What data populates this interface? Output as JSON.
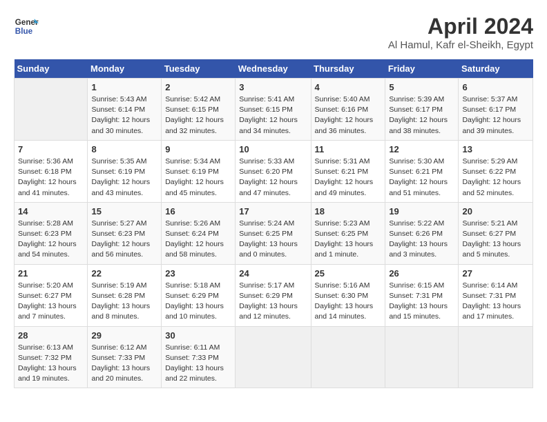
{
  "header": {
    "logo_line1": "General",
    "logo_line2": "Blue",
    "title": "April 2024",
    "subtitle": "Al Hamul, Kafr el-Sheikh, Egypt"
  },
  "calendar": {
    "days_of_week": [
      "Sunday",
      "Monday",
      "Tuesday",
      "Wednesday",
      "Thursday",
      "Friday",
      "Saturday"
    ],
    "weeks": [
      [
        {
          "day": "",
          "info": ""
        },
        {
          "day": "1",
          "info": "Sunrise: 5:43 AM\nSunset: 6:14 PM\nDaylight: 12 hours\nand 30 minutes."
        },
        {
          "day": "2",
          "info": "Sunrise: 5:42 AM\nSunset: 6:15 PM\nDaylight: 12 hours\nand 32 minutes."
        },
        {
          "day": "3",
          "info": "Sunrise: 5:41 AM\nSunset: 6:15 PM\nDaylight: 12 hours\nand 34 minutes."
        },
        {
          "day": "4",
          "info": "Sunrise: 5:40 AM\nSunset: 6:16 PM\nDaylight: 12 hours\nand 36 minutes."
        },
        {
          "day": "5",
          "info": "Sunrise: 5:39 AM\nSunset: 6:17 PM\nDaylight: 12 hours\nand 38 minutes."
        },
        {
          "day": "6",
          "info": "Sunrise: 5:37 AM\nSunset: 6:17 PM\nDaylight: 12 hours\nand 39 minutes."
        }
      ],
      [
        {
          "day": "7",
          "info": "Sunrise: 5:36 AM\nSunset: 6:18 PM\nDaylight: 12 hours\nand 41 minutes."
        },
        {
          "day": "8",
          "info": "Sunrise: 5:35 AM\nSunset: 6:19 PM\nDaylight: 12 hours\nand 43 minutes."
        },
        {
          "day": "9",
          "info": "Sunrise: 5:34 AM\nSunset: 6:19 PM\nDaylight: 12 hours\nand 45 minutes."
        },
        {
          "day": "10",
          "info": "Sunrise: 5:33 AM\nSunset: 6:20 PM\nDaylight: 12 hours\nand 47 minutes."
        },
        {
          "day": "11",
          "info": "Sunrise: 5:31 AM\nSunset: 6:21 PM\nDaylight: 12 hours\nand 49 minutes."
        },
        {
          "day": "12",
          "info": "Sunrise: 5:30 AM\nSunset: 6:21 PM\nDaylight: 12 hours\nand 51 minutes."
        },
        {
          "day": "13",
          "info": "Sunrise: 5:29 AM\nSunset: 6:22 PM\nDaylight: 12 hours\nand 52 minutes."
        }
      ],
      [
        {
          "day": "14",
          "info": "Sunrise: 5:28 AM\nSunset: 6:23 PM\nDaylight: 12 hours\nand 54 minutes."
        },
        {
          "day": "15",
          "info": "Sunrise: 5:27 AM\nSunset: 6:23 PM\nDaylight: 12 hours\nand 56 minutes."
        },
        {
          "day": "16",
          "info": "Sunrise: 5:26 AM\nSunset: 6:24 PM\nDaylight: 12 hours\nand 58 minutes."
        },
        {
          "day": "17",
          "info": "Sunrise: 5:24 AM\nSunset: 6:25 PM\nDaylight: 13 hours\nand 0 minutes."
        },
        {
          "day": "18",
          "info": "Sunrise: 5:23 AM\nSunset: 6:25 PM\nDaylight: 13 hours\nand 1 minute."
        },
        {
          "day": "19",
          "info": "Sunrise: 5:22 AM\nSunset: 6:26 PM\nDaylight: 13 hours\nand 3 minutes."
        },
        {
          "day": "20",
          "info": "Sunrise: 5:21 AM\nSunset: 6:27 PM\nDaylight: 13 hours\nand 5 minutes."
        }
      ],
      [
        {
          "day": "21",
          "info": "Sunrise: 5:20 AM\nSunset: 6:27 PM\nDaylight: 13 hours\nand 7 minutes."
        },
        {
          "day": "22",
          "info": "Sunrise: 5:19 AM\nSunset: 6:28 PM\nDaylight: 13 hours\nand 8 minutes."
        },
        {
          "day": "23",
          "info": "Sunrise: 5:18 AM\nSunset: 6:29 PM\nDaylight: 13 hours\nand 10 minutes."
        },
        {
          "day": "24",
          "info": "Sunrise: 5:17 AM\nSunset: 6:29 PM\nDaylight: 13 hours\nand 12 minutes."
        },
        {
          "day": "25",
          "info": "Sunrise: 5:16 AM\nSunset: 6:30 PM\nDaylight: 13 hours\nand 14 minutes."
        },
        {
          "day": "26",
          "info": "Sunrise: 6:15 AM\nSunset: 7:31 PM\nDaylight: 13 hours\nand 15 minutes."
        },
        {
          "day": "27",
          "info": "Sunrise: 6:14 AM\nSunset: 7:31 PM\nDaylight: 13 hours\nand 17 minutes."
        }
      ],
      [
        {
          "day": "28",
          "info": "Sunrise: 6:13 AM\nSunset: 7:32 PM\nDaylight: 13 hours\nand 19 minutes."
        },
        {
          "day": "29",
          "info": "Sunrise: 6:12 AM\nSunset: 7:33 PM\nDaylight: 13 hours\nand 20 minutes."
        },
        {
          "day": "30",
          "info": "Sunrise: 6:11 AM\nSunset: 7:33 PM\nDaylight: 13 hours\nand 22 minutes."
        },
        {
          "day": "",
          "info": ""
        },
        {
          "day": "",
          "info": ""
        },
        {
          "day": "",
          "info": ""
        },
        {
          "day": "",
          "info": ""
        }
      ]
    ]
  }
}
